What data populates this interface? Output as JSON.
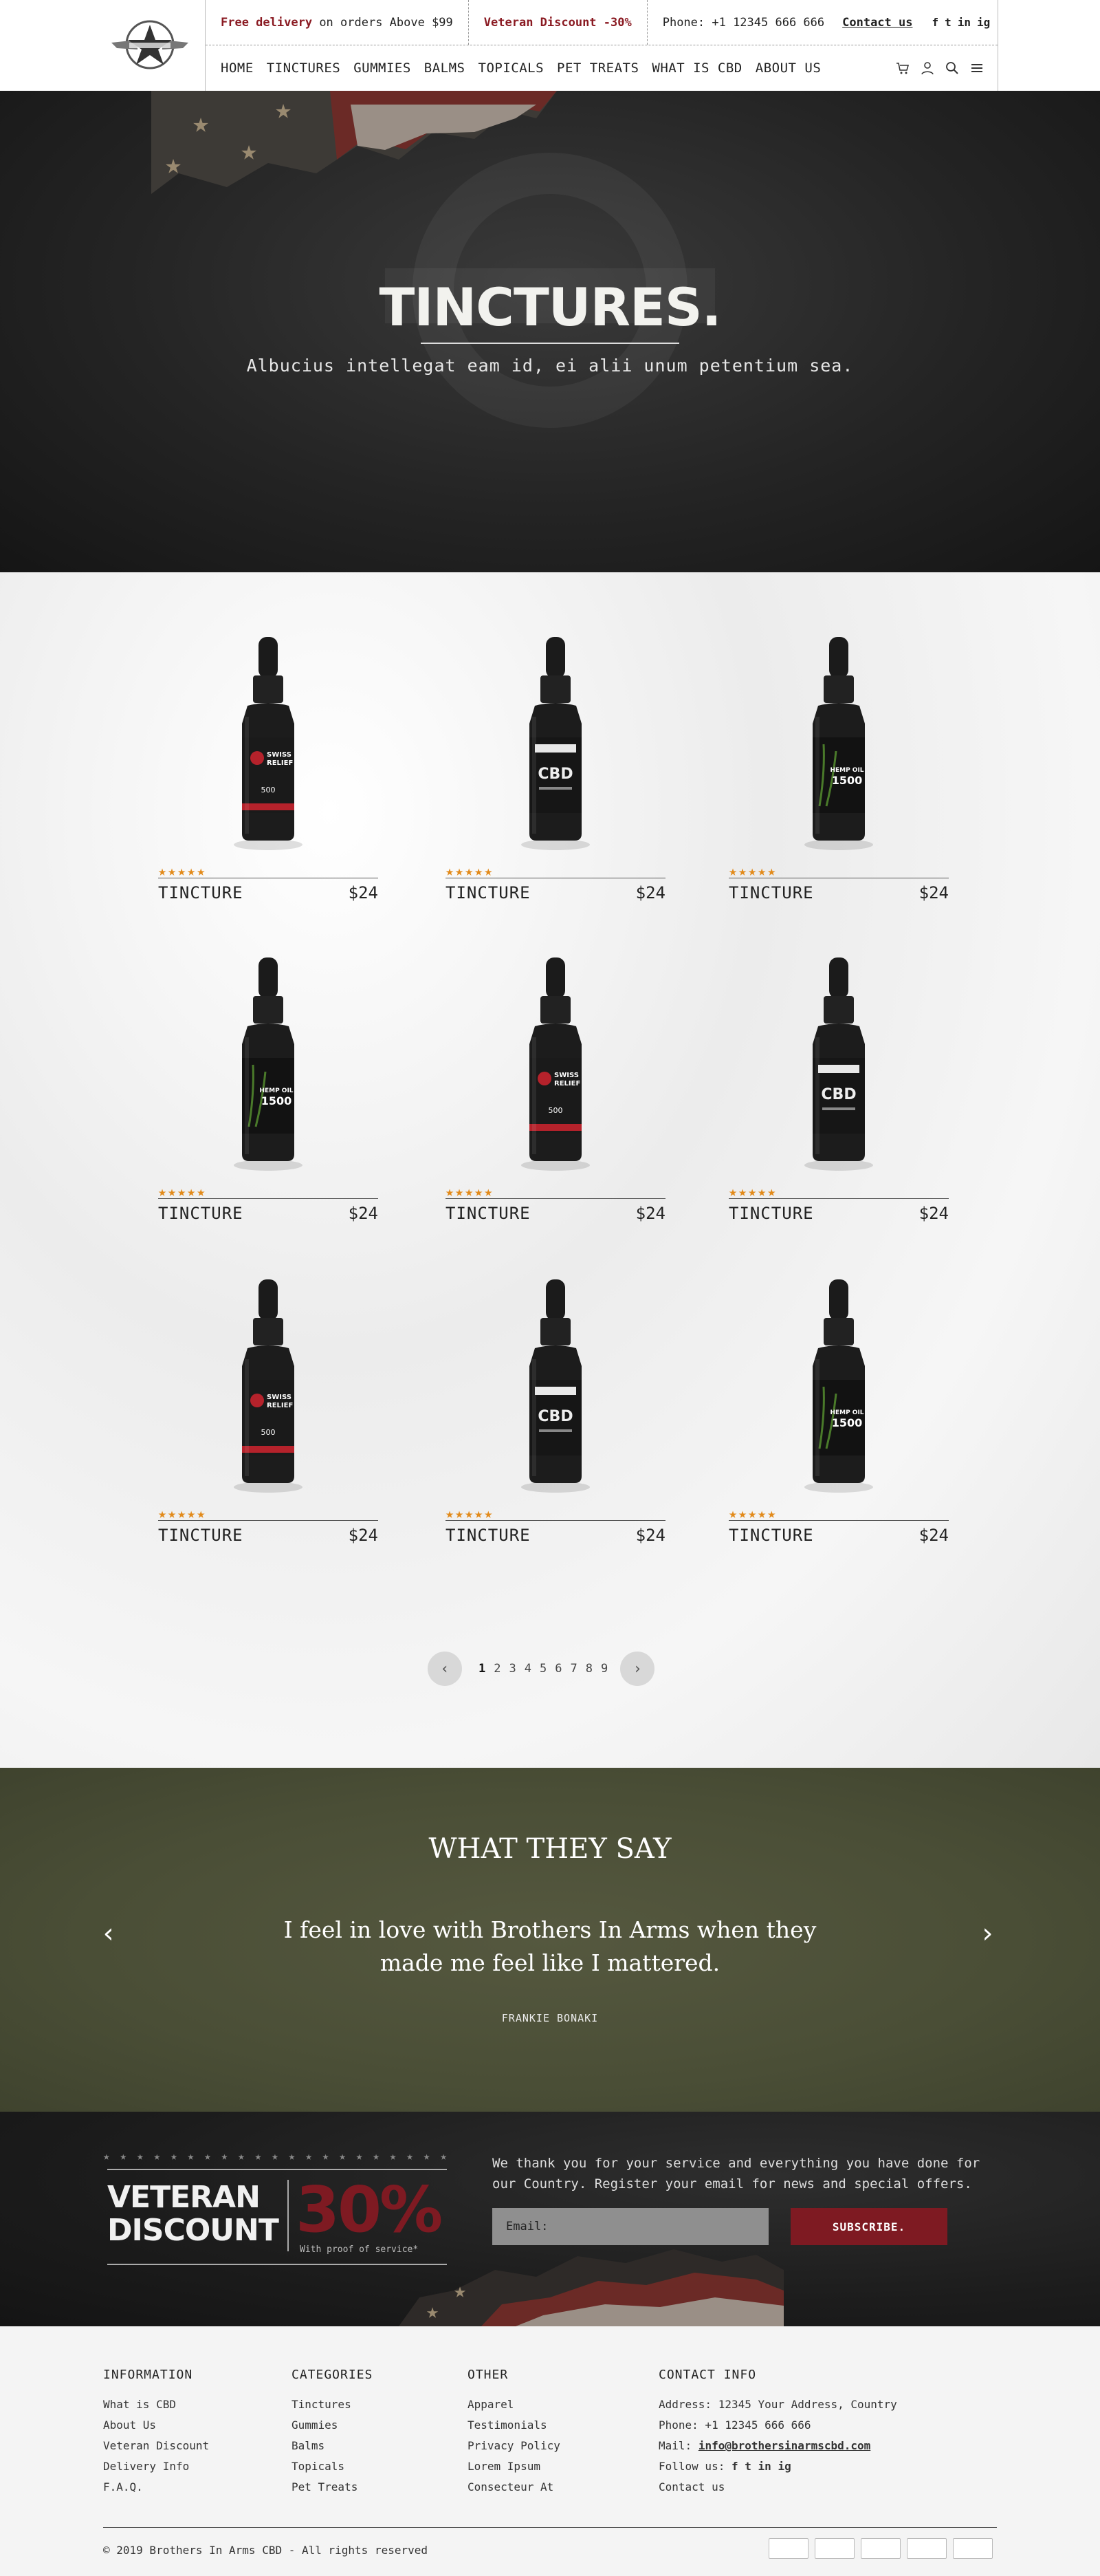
{
  "header": {
    "logo": "brothers-in-arms-star-emblem",
    "free_delivery": "Free delivery",
    "free_delivery_note": "on orders Above $99",
    "veteran_discount": "Veteran Discount -30%",
    "phone": "Phone: +1 12345 666 666",
    "contact_link": "Contact us",
    "social": [
      "f",
      "t",
      "in",
      "ig"
    ],
    "nav": [
      "HOME",
      "TINCTURES",
      "GUMMIES",
      "BALMS",
      "TOPICALS",
      "PET TREATS",
      "WHAT IS CBD",
      "ABOUT US"
    ],
    "icons": [
      "cart-icon",
      "user-icon",
      "search-icon",
      "menu-icon"
    ]
  },
  "hero": {
    "title": "TINCTURES.",
    "subtitle": "Albucius intellegat eam id, ei alii unum petentium sea."
  },
  "products": [
    {
      "name": "TINCTURE",
      "price": "$24",
      "rating": 5,
      "variant": "swiss"
    },
    {
      "name": "TINCTURE",
      "price": "$24",
      "rating": 5,
      "variant": "cbd"
    },
    {
      "name": "TINCTURE",
      "price": "$24",
      "rating": 5,
      "variant": "hemp"
    },
    {
      "name": "TINCTURE",
      "price": "$24",
      "rating": 5,
      "variant": "hemp"
    },
    {
      "name": "TINCTURE",
      "price": "$24",
      "rating": 5,
      "variant": "swiss"
    },
    {
      "name": "TINCTURE",
      "price": "$24",
      "rating": 5,
      "variant": "cbd"
    },
    {
      "name": "TINCTURE",
      "price": "$24",
      "rating": 5,
      "variant": "swiss"
    },
    {
      "name": "TINCTURE",
      "price": "$24",
      "rating": 5,
      "variant": "cbd"
    },
    {
      "name": "TINCTURE",
      "price": "$24",
      "rating": 5,
      "variant": "hemp"
    }
  ],
  "bottle_labels": {
    "swiss_1": "SWISS",
    "swiss_2": "RELIEF",
    "swiss_3": "500",
    "cbd_1": "CBD",
    "hemp_1": "HEMP OIL",
    "hemp_2": "1500"
  },
  "pagination": {
    "pages": [
      "1",
      "2",
      "3",
      "4",
      "5",
      "6",
      "7",
      "8",
      "9"
    ],
    "current": "1",
    "prev_icon": "chevron-left-icon",
    "next_icon": "chevron-right-icon"
  },
  "testimonial": {
    "title": "WHAT THEY SAY",
    "quote": "I feel in love with Brothers In Arms when they made me feel like I mattered.",
    "author": "FRANKIE BONAKI"
  },
  "subscribe": {
    "badge_word1": "VETERAN",
    "badge_word2": "DISCOUNT",
    "badge_percent": "30%",
    "badge_note": "With proof of service*",
    "text": "We thank you for your service and everything you have done for our Country. Register your email for news and special offers.",
    "email_placeholder": "Email:",
    "button": "SUBSCRIBE."
  },
  "footer": {
    "information": {
      "title": "INFORMATION",
      "links": [
        "What is CBD",
        "About Us",
        "Veteran Discount",
        "Delivery Info",
        "F.A.Q."
      ]
    },
    "categories": {
      "title": "CATEGORIES",
      "links": [
        "Tinctures",
        "Gummies",
        "Balms",
        "Topicals",
        "Pet Treats"
      ]
    },
    "other": {
      "title": "OTHER",
      "links": [
        "Apparel",
        "Testimonials",
        "Privacy Policy",
        "Lorem Ipsum",
        "Consecteur At"
      ]
    },
    "contact": {
      "title": "CONTACT INFO",
      "address": "Address: 12345 Your Address, Country",
      "phone": "Phone: +1 12345 666 666",
      "mail_label": "Mail:",
      "mail": "info@brothersinarmscbd.com",
      "follow": "Follow us:",
      "contact_link": "Contact us"
    },
    "copyright": "© 2019 Brothers In Arms CBD - All rights reserved",
    "payment_icons": [
      "payment-icon-1",
      "payment-icon-2",
      "payment-icon-3",
      "payment-icon-4",
      "payment-icon-5"
    ]
  },
  "colors": {
    "accent_red": "#7e1a22",
    "star_orange": "#e28a1a",
    "olive": "#4a4e36"
  }
}
